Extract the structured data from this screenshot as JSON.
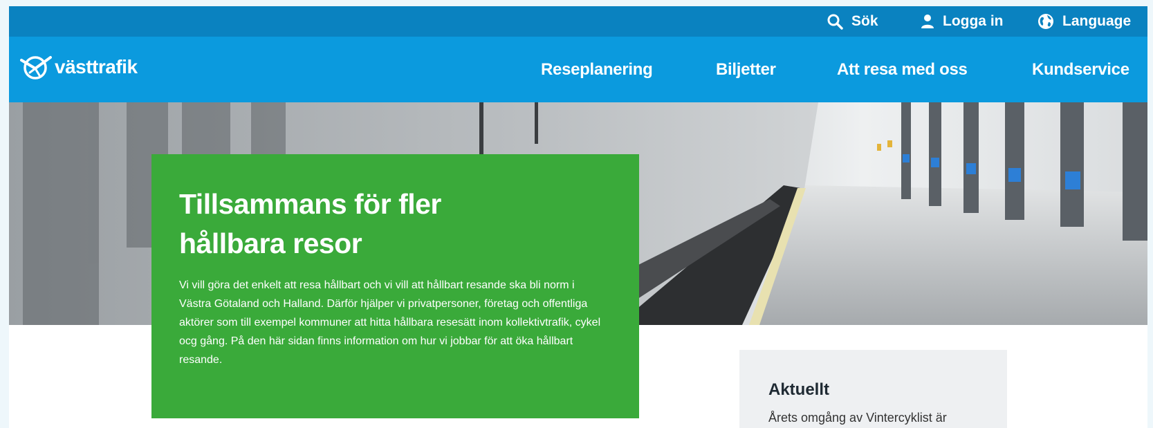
{
  "utility_nav": {
    "search_label": "Sök",
    "login_label": "Logga in",
    "language_label": "Language"
  },
  "brand": {
    "logo_text": "västtrafik"
  },
  "main_nav": [
    {
      "label": "Reseplanering"
    },
    {
      "label": "Biljetter"
    },
    {
      "label": "Att resa med oss"
    },
    {
      "label": "Kundservice"
    }
  ],
  "hero": {
    "title": "Tillsammans för fler hållbara resor",
    "body": "Vi vill göra det enkelt att resa hållbart och vi vill att hållbart resande ska bli norm i Västra Götaland och Halland. Därför hjälper vi privatpersoner, företag och offentliga aktörer som till exempel kommuner att hitta hållbara resesätt inom kollektivtrafik, cykel ocg gång. På den här sidan finns information om hur vi jobbar för att öka hållbart resande."
  },
  "aside": {
    "heading": "Aktuellt",
    "teaser": "Årets omgång av Vintercyklist är"
  },
  "colors": {
    "utility_bar": "#0a82c0",
    "nav_bar": "#0b9ade",
    "hero_card": "#3aaa3a",
    "aside_bg": "#eef0f2"
  }
}
